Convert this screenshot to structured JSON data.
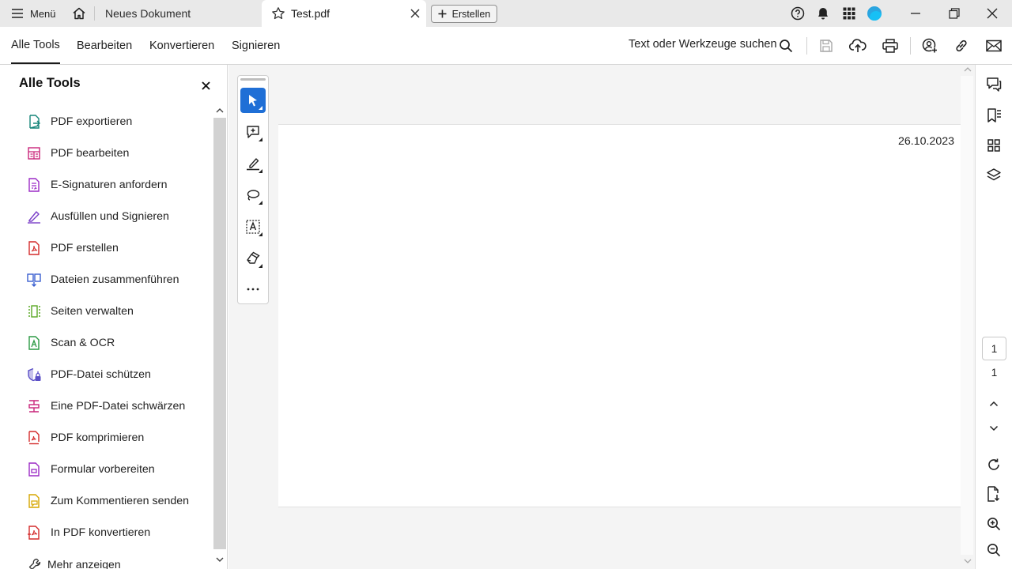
{
  "titlebar": {
    "menu_label": "Menü",
    "tab_inactive_label": "Neues Dokument",
    "tab_active_label": "Test.pdf",
    "create_label": "Erstellen"
  },
  "menubar": {
    "items": [
      "Alle Tools",
      "Bearbeiten",
      "Konvertieren",
      "Signieren"
    ],
    "active": "Alle Tools",
    "search_label": "Text oder Werkzeuge suchen"
  },
  "left_panel": {
    "title": "Alle Tools",
    "tools": [
      {
        "label": "PDF exportieren",
        "icon": "export-pdf-icon",
        "color": "#16857a"
      },
      {
        "label": "PDF bearbeiten",
        "icon": "edit-pdf-icon",
        "color": "#c9257a"
      },
      {
        "label": "E-Signaturen anfordern",
        "icon": "request-esign-icon",
        "color": "#9c2cc6"
      },
      {
        "label": "Ausfüllen und Signieren",
        "icon": "fill-sign-icon",
        "color": "#7a3ec8"
      },
      {
        "label": "PDF erstellen",
        "icon": "create-pdf-icon",
        "color": "#d42c2c"
      },
      {
        "label": "Dateien zusammenführen",
        "icon": "combine-files-icon",
        "color": "#3a5fd0"
      },
      {
        "label": "Seiten verwalten",
        "icon": "organize-pages-icon",
        "color": "#5aa826"
      },
      {
        "label": "Scan & OCR",
        "icon": "scan-ocr-icon",
        "color": "#2c9a44"
      },
      {
        "label": "PDF-Datei schützen",
        "icon": "protect-pdf-icon",
        "color": "#5b4fc7"
      },
      {
        "label": "Eine PDF-Datei schwärzen",
        "icon": "redact-pdf-icon",
        "color": "#c9257a"
      },
      {
        "label": "PDF komprimieren",
        "icon": "compress-pdf-icon",
        "color": "#d42c2c"
      },
      {
        "label": "Formular vorbereiten",
        "icon": "prepare-form-icon",
        "color": "#9c2cc6"
      },
      {
        "label": "Zum Kommentieren senden",
        "icon": "send-comments-icon",
        "color": "#d6a600"
      },
      {
        "label": "In PDF konvertieren",
        "icon": "convert-pdf-icon",
        "color": "#d42c2c"
      }
    ],
    "more_label": "Mehr anzeigen"
  },
  "document": {
    "date_text": "26.10.2023"
  },
  "right_rail": {
    "current_page": "1",
    "total_pages": "1"
  },
  "colors": {
    "accent": "#1f6fd6",
    "titlebar_bg": "#e9e9e9",
    "doc_bg": "#f4f4f4"
  }
}
